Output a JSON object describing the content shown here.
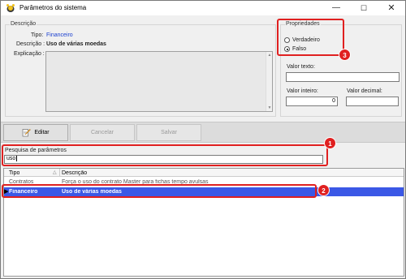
{
  "window": {
    "title": "Parâmetros do sistema",
    "controls": {
      "minimize": "—",
      "maximize": "☐",
      "close": "✕"
    }
  },
  "descricao_group": {
    "title": "Descrição",
    "tipo_label": "Tipo:",
    "tipo_value": "Financeiro",
    "descricao_label": "Descrição :",
    "descricao_value": "Uso de várias moedas",
    "explicacao_label": "Explicação :"
  },
  "propriedades_group": {
    "title": "Propriedades",
    "options": [
      {
        "label": "Verdadeiro",
        "checked": false
      },
      {
        "label": "Falso",
        "checked": true
      }
    ],
    "valor_texto_label": "Valor texto:",
    "valor_texto_value": "",
    "valor_inteiro_label": "Valor inteiro:",
    "valor_inteiro_value": "0",
    "valor_decimal_label": "Valor decimal:",
    "valor_decimal_value": ""
  },
  "toolbar": {
    "editar_label": "Editar",
    "cancelar_label": "Cancelar",
    "salvar_label": "Salvar"
  },
  "search": {
    "label": "Pesquisa de parâmetros",
    "value": "uso"
  },
  "grid": {
    "columns": [
      "Tipo",
      "Descrição"
    ],
    "rows": [
      {
        "tipo": "Contratos",
        "descricao": "Força o uso do contrato Master para fichas tempo avulsas",
        "selected": false
      },
      {
        "tipo": "Financeiro",
        "descricao": "Uso de várias moedas",
        "selected": true
      }
    ]
  },
  "callouts": [
    "1",
    "2",
    "3"
  ],
  "colors": {
    "callout": "#e02020",
    "selection": "#3b58e6",
    "link": "#1a3fd0"
  }
}
